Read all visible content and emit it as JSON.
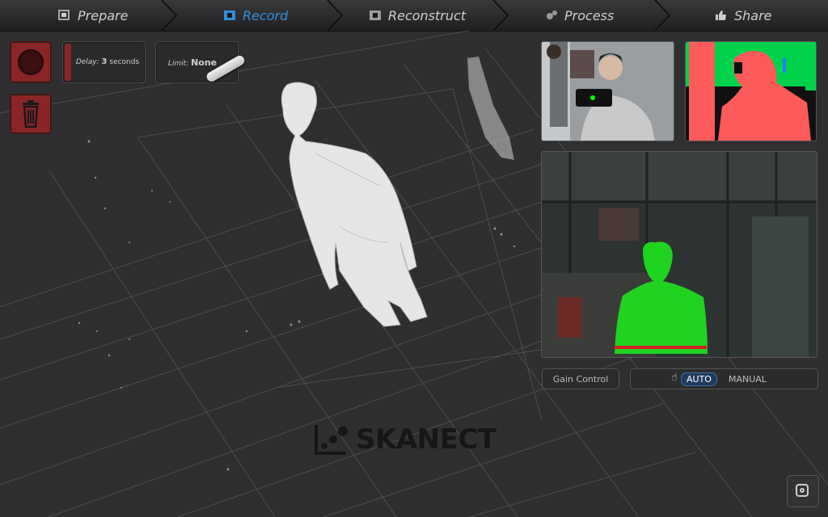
{
  "nav": {
    "tabs": [
      {
        "label": "Prepare",
        "icon": "prepare-icon"
      },
      {
        "label": "Record",
        "icon": "film-icon",
        "active": true
      },
      {
        "label": "Reconstruct",
        "icon": "film-icon"
      },
      {
        "label": "Process",
        "icon": "gear-icon"
      },
      {
        "label": "Share",
        "icon": "thumbs-up-icon"
      }
    ]
  },
  "controls": {
    "delay_label": "Delay:",
    "delay_value": "3",
    "delay_unit": "seconds",
    "limit_label": "Limit:",
    "limit_value": "None"
  },
  "camera": {
    "gain_label": "Gain Control",
    "mode_auto": "AUTO",
    "mode_manual": "MANUAL"
  },
  "brand": {
    "logo_text": "SKANECT"
  },
  "colors": {
    "accent": "#2f8fe0",
    "record_red": "#8b2525",
    "depth_green": "#00e000",
    "depth_red": "#ff4d4d"
  }
}
